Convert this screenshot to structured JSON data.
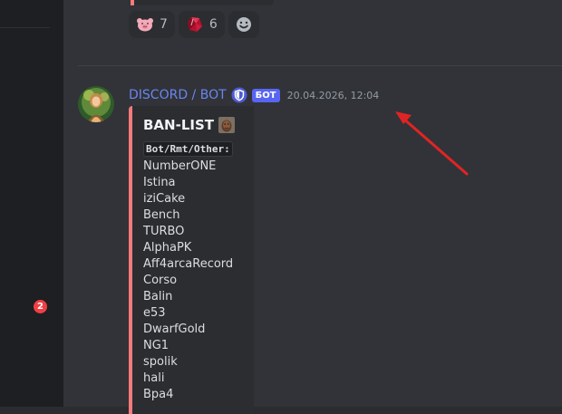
{
  "sidebar": {
    "mention_count": "2"
  },
  "reactions": [
    {
      "icon": "pig-emoji-icon",
      "count": "7"
    },
    {
      "icon": "red-gem-emoji-icon",
      "count": "6"
    },
    {
      "icon": "add-reaction-smile-icon"
    }
  ],
  "message": {
    "author": "DISCORD / BOT",
    "bot_tag": "БОТ",
    "timestamp": "20.04.2026, 12:04",
    "accent_color": "#f47b7b",
    "username_color": "#6b85f0",
    "embed": {
      "title": "BAN-LIST",
      "code_label": "Bot/Rmt/Other:",
      "names": [
        "NumberONE",
        "Istina",
        "iziCake",
        "Bench",
        "TURBO",
        "AlphaPK",
        "Aff4arcaRecord",
        "Corso",
        "Balin",
        "e53",
        "DwarfGold",
        "NG1",
        "spolik",
        "hali",
        "Bpa4"
      ]
    }
  },
  "annotation": {
    "arrow_color": "#e02424"
  }
}
